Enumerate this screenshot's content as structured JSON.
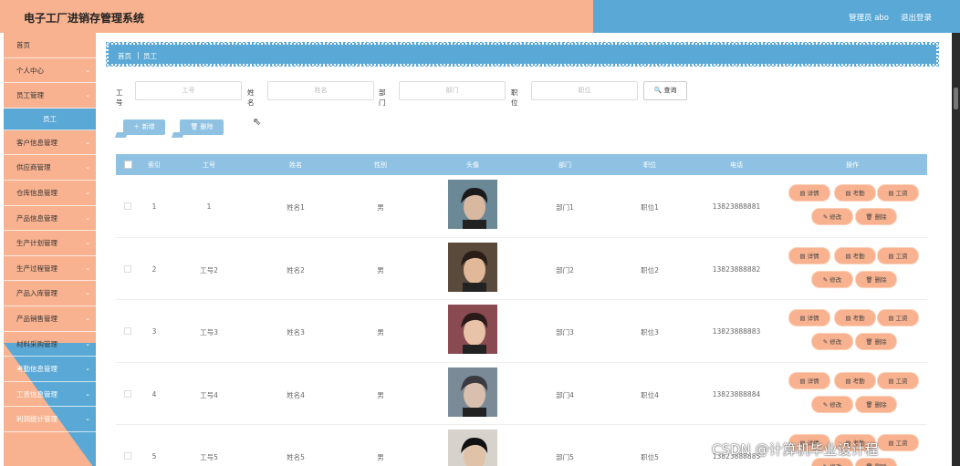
{
  "header": {
    "title": "电子工厂进销存管理系统",
    "admin": "管理员 abo",
    "logout": "退出登录"
  },
  "sidebar": {
    "items": [
      {
        "label": "首页",
        "chev": ""
      },
      {
        "label": "个人中心",
        "chev": "⌄"
      },
      {
        "label": "员工管理",
        "chev": "⌄"
      },
      {
        "label": "员工",
        "chev": "",
        "sub": true
      },
      {
        "label": "客户信息管理",
        "chev": "⌄"
      },
      {
        "label": "供应商管理",
        "chev": "⌄"
      },
      {
        "label": "仓库信息管理",
        "chev": "⌄"
      },
      {
        "label": "产品信息管理",
        "chev": "⌄"
      },
      {
        "label": "生产计划管理",
        "chev": "⌄"
      },
      {
        "label": "生产过程管理",
        "chev": "⌄"
      },
      {
        "label": "产品入库管理",
        "chev": "⌄"
      },
      {
        "label": "产品销售管理",
        "chev": "⌄"
      },
      {
        "label": "材料采购管理",
        "chev": "⌄"
      },
      {
        "label": "考勤信息管理",
        "chev": "⌄"
      },
      {
        "label": "工资信息管理",
        "chev": "⌄"
      },
      {
        "label": "利润统计管理",
        "chev": "⌄"
      }
    ]
  },
  "breadcrumb": {
    "home": "首页",
    "sep": "|",
    "current": "员工"
  },
  "search": {
    "fields": [
      {
        "label": "工号",
        "placeholder": "工号"
      },
      {
        "label": "姓名",
        "placeholder": "姓名"
      },
      {
        "label": "部门",
        "placeholder": "部门"
      },
      {
        "label": "职位",
        "placeholder": "职位"
      }
    ],
    "button": "🔍 查询"
  },
  "actions": {
    "add": "＋ 新增",
    "delete": "🗑 删除"
  },
  "table": {
    "headers": [
      "索引",
      "工号",
      "姓名",
      "性别",
      "头像",
      "部门",
      "职位",
      "电话",
      "操作"
    ],
    "rows": [
      {
        "index": "1",
        "id": "1",
        "name": "姓名1",
        "gender": "男",
        "dept": "部门1",
        "position": "职位1",
        "phone": "13823888881"
      },
      {
        "index": "2",
        "id": "工号2",
        "name": "姓名2",
        "gender": "男",
        "dept": "部门2",
        "position": "职位2",
        "phone": "13823888882"
      },
      {
        "index": "3",
        "id": "工号3",
        "name": "姓名3",
        "gender": "男",
        "dept": "部门3",
        "position": "职位3",
        "phone": "13823888883"
      },
      {
        "index": "4",
        "id": "工号4",
        "name": "姓名4",
        "gender": "男",
        "dept": "部门4",
        "position": "职位4",
        "phone": "13823888884"
      },
      {
        "index": "5",
        "id": "工号5",
        "name": "姓名5",
        "gender": "男",
        "dept": "部门5",
        "position": "职位5",
        "phone": "13823888885"
      }
    ],
    "ops": {
      "detail": "▤ 详情",
      "attendance": "▤ 考勤",
      "salary": "▤ 工资",
      "edit": "✎ 修改",
      "remove": "🗑 删除"
    }
  },
  "watermark": "CSDN @计算机毕业设计程",
  "colors": {
    "accent_orange": "#f8b28f",
    "accent_blue": "#5aa8d6",
    "table_header": "#8fc2e2"
  }
}
